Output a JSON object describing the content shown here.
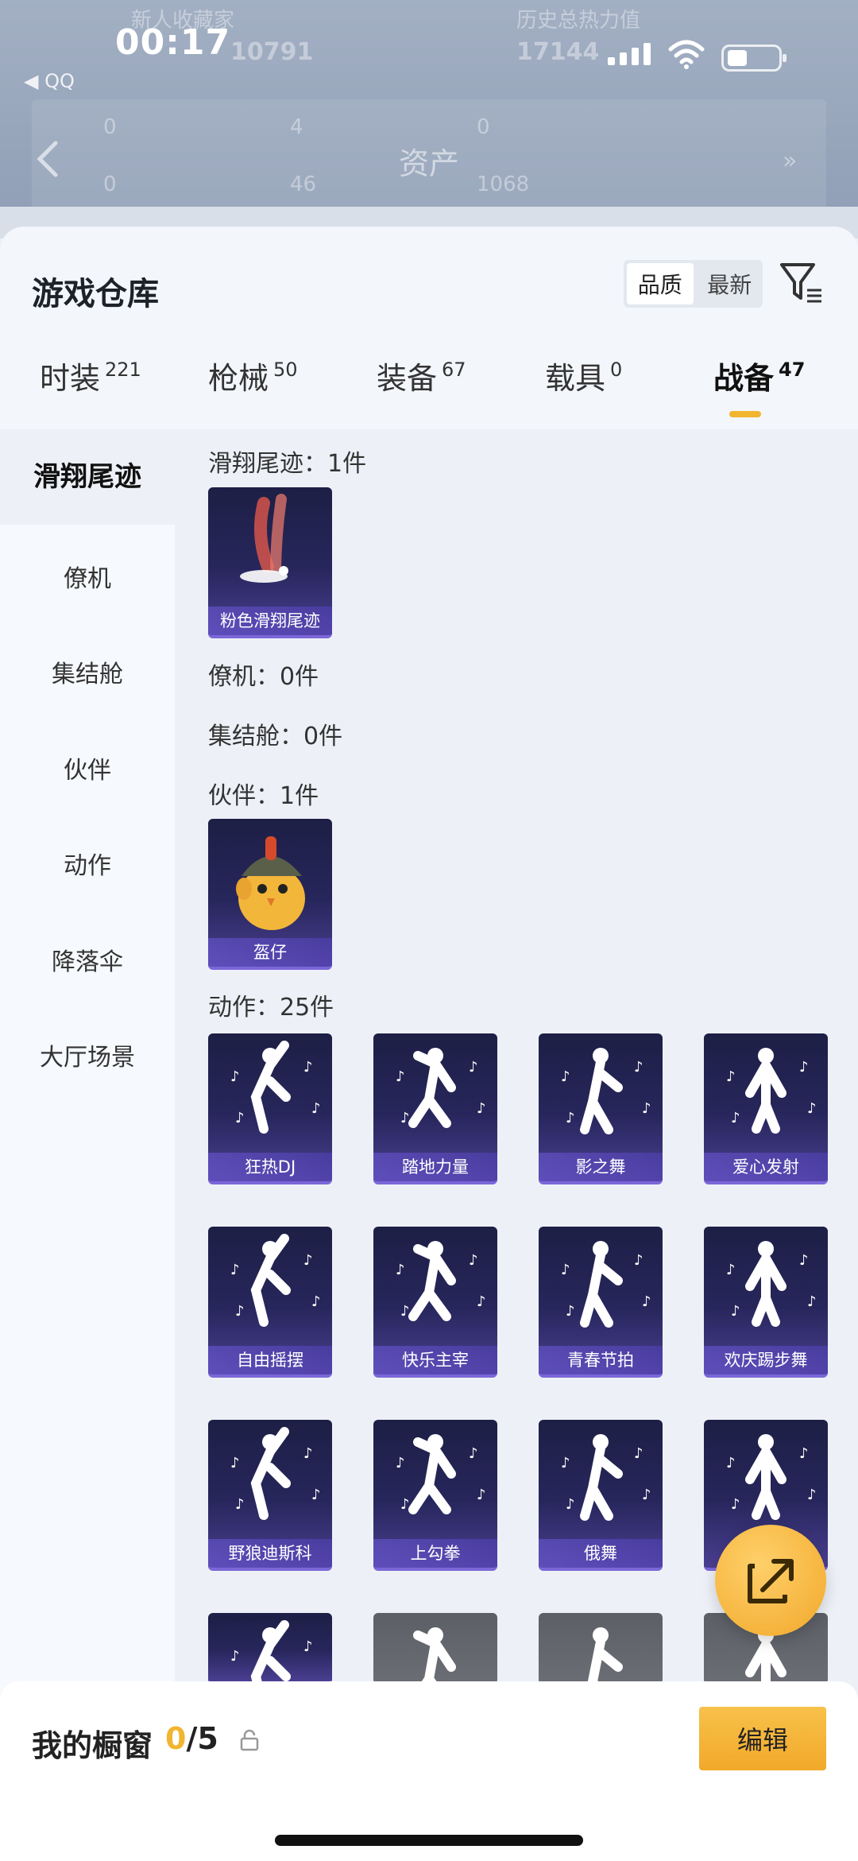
{
  "status_bar": {
    "time": "00:17",
    "back_app": "◀ QQ"
  },
  "background_header": {
    "ghost_texts": [
      "新人收藏家",
      "历史总热力值",
      "10791",
      "17144",
      "0",
      "4",
      "0",
      "0",
      "46",
      "1068"
    ],
    "assets_title": "资产",
    "forward": "»"
  },
  "warehouse": {
    "title": "游戏仓库",
    "sort_options": [
      "品质",
      "最新"
    ],
    "sort_active": "品质"
  },
  "tabs": [
    {
      "label": "时装",
      "count": "221"
    },
    {
      "label": "枪械",
      "count": "50"
    },
    {
      "label": "装备",
      "count": "67"
    },
    {
      "label": "载具",
      "count": "0"
    },
    {
      "label": "战备",
      "count": "47"
    }
  ],
  "active_tab": "战备",
  "left_nav": [
    "滑翔尾迹",
    "僚机",
    "集结舱",
    "伙伴",
    "动作",
    "降落伞",
    "大厅场景"
  ],
  "sections": {
    "trail": {
      "label": "滑翔尾迹：1件",
      "items": [
        "粉色滑翔尾迹"
      ]
    },
    "wingman": {
      "label": "僚机：0件"
    },
    "capsule": {
      "label": "集结舱：0件"
    },
    "partner": {
      "label": "伙伴：1件",
      "items": [
        "盔仔"
      ]
    },
    "emote": {
      "label": "动作：25件",
      "items": [
        "狂热DJ",
        "踏地力量",
        "影之舞",
        "爱心发射",
        "自由摇摆",
        "快乐主宰",
        "青春节拍",
        "欢庆踢步舞",
        "野狼迪斯科",
        "上勾拳",
        "俄舞"
      ]
    }
  },
  "bottom_bar": {
    "label": "我的橱窗",
    "current": "0",
    "total": "/5",
    "edit_label": "编辑"
  },
  "colors": {
    "accent": "#f1b530",
    "card_dark": "#1d1f45",
    "card_purple": "#4b3f92"
  }
}
